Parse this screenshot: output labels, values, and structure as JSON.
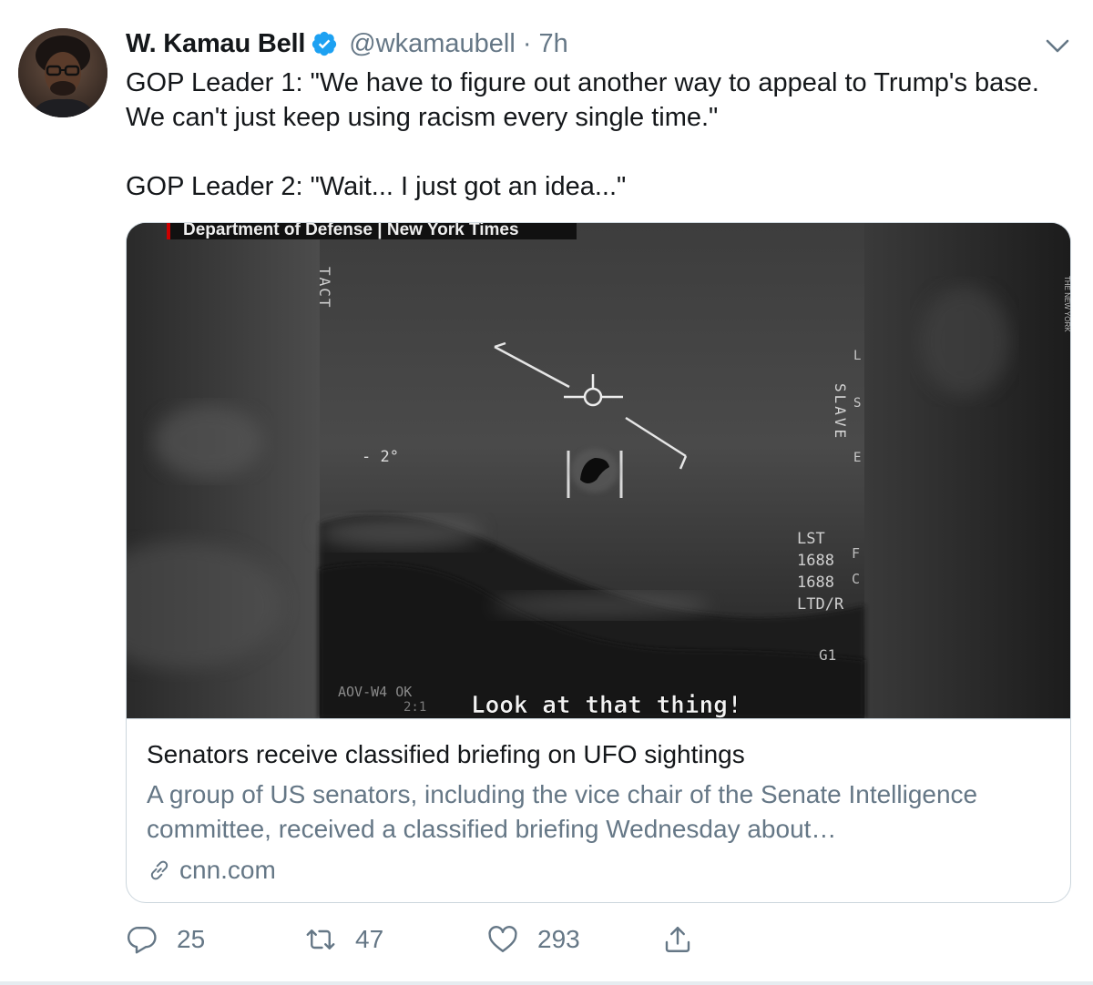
{
  "tweet": {
    "author": {
      "display_name": "W. Kamau Bell",
      "handle": "@wkamaubell",
      "separator": "·",
      "timestamp": "7h",
      "verified_icon": "verified-badge-icon"
    },
    "text": "GOP Leader 1: \"We have to figure out another way to appeal to Trump's base. We can't just keep using racism every single time.\"\n\nGOP Leader 2: \"Wait... I just got an idea...\"",
    "menu_icon": "chevron-down-icon"
  },
  "card": {
    "image": {
      "banner": "Department of Defense | New York Times",
      "watermark": "THE NEW YORK",
      "hud_left": "TACT",
      "hud_angle": "- 2°",
      "hud_slave": "SLAVE",
      "hud_data": [
        "LST",
        "1688",
        "1688",
        "LTD/R"
      ],
      "hud_g1": "G1",
      "hud_bottom_left": "AOV-W4 OK",
      "hud_bottom_left2": "2:1",
      "caption": "Look at that thing!"
    },
    "title": "Senators receive classified briefing on UFO sightings",
    "description": "A group of US senators, including the vice chair of the Senate Intelligence committee, received a classified briefing Wednesday about…",
    "domain": "cnn.com",
    "link_icon": "link-icon"
  },
  "actions": {
    "reply": {
      "icon": "reply-icon",
      "count": "25"
    },
    "retweet": {
      "icon": "retweet-icon",
      "count": "47"
    },
    "like": {
      "icon": "heart-icon",
      "count": "293"
    },
    "share": {
      "icon": "share-icon"
    }
  },
  "colors": {
    "text_primary": "#14171a",
    "text_secondary": "#657786",
    "verified_blue": "#1da1f2",
    "border": "#ccd6dd"
  }
}
